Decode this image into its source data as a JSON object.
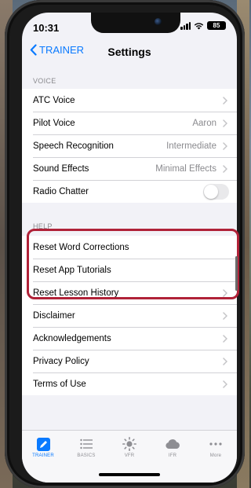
{
  "status": {
    "time": "10:31",
    "battery": "85"
  },
  "nav": {
    "back_label": "TRAINER",
    "title": "Settings"
  },
  "voice_section": {
    "header": "VOICE",
    "rows": [
      {
        "label": "ATC Voice",
        "value": ""
      },
      {
        "label": "Pilot Voice",
        "value": "Aaron"
      },
      {
        "label": "Speech Recognition",
        "value": "Intermediate"
      },
      {
        "label": "Sound Effects",
        "value": "Minimal Effects"
      },
      {
        "label": "Radio Chatter",
        "toggle": false
      }
    ]
  },
  "help_section": {
    "header": "HELP",
    "rows": [
      {
        "label": "Reset Word Corrections"
      },
      {
        "label": "Reset App Tutorials"
      },
      {
        "label": "Reset Lesson History"
      },
      {
        "label": "Disclaimer"
      },
      {
        "label": "Acknowledgements"
      },
      {
        "label": "Privacy Policy"
      },
      {
        "label": "Terms of Use"
      }
    ]
  },
  "tabs": [
    {
      "label": "TRAINER",
      "icon": "pencil-icon",
      "active": true
    },
    {
      "label": "BASICS",
      "icon": "list-icon",
      "active": false
    },
    {
      "label": "VFR",
      "icon": "sun-icon",
      "active": false
    },
    {
      "label": "IFR",
      "icon": "cloud-icon",
      "active": false
    },
    {
      "label": "More",
      "icon": "ellipsis-icon",
      "active": false
    }
  ],
  "colors": {
    "accent": "#0a7aff",
    "highlight_border": "#b02238",
    "background": "#f2f2f7"
  }
}
